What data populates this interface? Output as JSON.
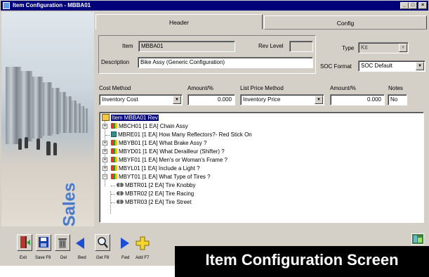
{
  "window": {
    "title": "Item Configuration - MBBA01"
  },
  "tabs": [
    {
      "label": "Header"
    },
    {
      "label": "Config"
    }
  ],
  "header": {
    "item_label": "Item",
    "item_value": "MBBA01",
    "rev_label": "Rev Level",
    "rev_value": "",
    "desc_label": "Description",
    "desc_value": "Bike Assy (Generic Configuration)",
    "type_label": "Type",
    "type_value": "Kit",
    "soc_label": "SOC Format",
    "soc_value": "SOC Default"
  },
  "pricing": {
    "cost_method_label": "Cost Method",
    "cost_method_value": "Inventory Cost",
    "amount1_label": "Amount/%",
    "amount1_value": "0.000",
    "list_method_label": "List Price Method",
    "list_method_value": "Inventory Price",
    "amount2_label": "Amount/%",
    "amount2_value": "0.000",
    "notes_label": "Notes",
    "notes_value": "No"
  },
  "tree": {
    "root": "Item MBBA01 Rev",
    "items": [
      {
        "text": "MBCH01 [1 EA] Chain Assy",
        "icon": "feature-icon",
        "expander": "+"
      },
      {
        "text": "MBRE01 [1 EA] How Many Reflectors?- Red Stick On",
        "icon": "grid-icon",
        "expander": ""
      },
      {
        "text": "MBYB01 [1 EA] What Brake Assy ?",
        "icon": "feature-icon",
        "expander": "+"
      },
      {
        "text": "MBYD01 [1 EA] What Derailleur (Shifter) ?",
        "icon": "feature-icon",
        "expander": "+"
      },
      {
        "text": "MBYF01 [1 EA] Men's or Woman's Frame ?",
        "icon": "feature-icon",
        "expander": "+"
      },
      {
        "text": "MBYL01 [1 EA] Include a Light ?",
        "icon": "feature-icon",
        "expander": "+"
      },
      {
        "text": "MBYT01 [1 EA] What Type of Tires ?",
        "icon": "feature-icon",
        "expander": "-"
      }
    ],
    "children": [
      {
        "text": "MBTR01 [2 EA] Tire Knobby",
        "icon": "option-icon"
      },
      {
        "text": "MBTR02 [2 EA] Tire Racing",
        "icon": "option-icon"
      },
      {
        "text": "MBTR03 [2 EA] Tire Street",
        "icon": "option-icon"
      }
    ]
  },
  "sidebar": {
    "brand_text": "Sales"
  },
  "toolbar": {
    "exit": "Exit",
    "save": "Save F9",
    "del": "Del",
    "bwd": "Bwd",
    "get": "Get F8",
    "fwd": "Fwd",
    "add": "Add F7"
  },
  "caption": "Item Configuration Screen"
}
